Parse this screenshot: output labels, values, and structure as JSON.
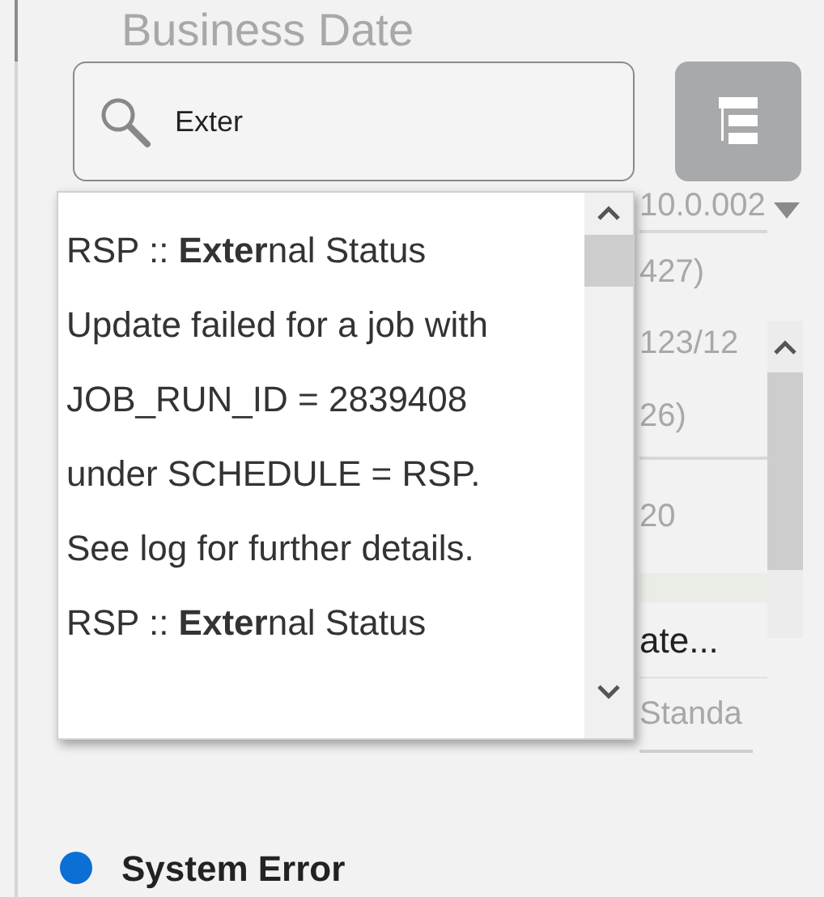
{
  "header": {
    "title": "Business Date"
  },
  "search": {
    "value": "Exter"
  },
  "suggestions": [
    {
      "text": "RSP :: **Exter**nal Status Update failed for a job with JOB_RUN_ID = 2839408 under SCHEDULE = RSP. See log for further details."
    },
    {
      "text": "RSP :: **Exter**nal Status"
    }
  ],
  "background_cells": [
    "10.0.002",
    "427)",
    "123/12",
    "26)",
    "20",
    "ate...",
    "Standa"
  ],
  "status": {
    "label": "System Error",
    "color": "#0b6fd6"
  }
}
